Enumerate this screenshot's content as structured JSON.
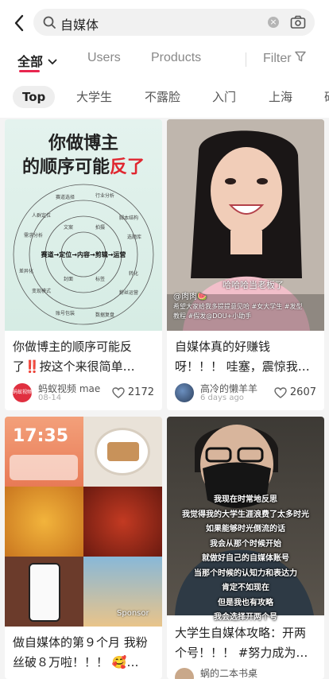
{
  "search": {
    "query": "自媒体"
  },
  "tabs": [
    {
      "label": "全部"
    },
    {
      "label": "Users"
    },
    {
      "label": "Products"
    },
    {
      "label": "Filter"
    }
  ],
  "chips": [
    "Top",
    "大学生",
    "不露脸",
    "入门",
    "上海",
    "研"
  ],
  "posts": [
    {
      "thumb_title_line1": "你做博主",
      "thumb_title_line2a": "的顺序可能",
      "thumb_title_line2b": "反了",
      "diagram_center": "赛道→定位→内容→剪辑→运营",
      "title_line1": "你做博主的顺序可能反",
      "title_line2": "了‼️按这个来很简单…",
      "author": "蚂蚁视频 mae",
      "date": "08-14",
      "avatar_text": "蚂蚁视频",
      "likes": "2172"
    },
    {
      "overlay_name": "@肉肉🍉",
      "overlay_caption": "哈哈哈当老板了",
      "overlay_small": "希望大家给我多提提意见哈 #女大学生 #发型教程 #假发@DOU+小助手",
      "title_line1": "自媒体真的好赚钱",
      "title_line2": "呀！！！ 哇塞，震惊我…",
      "author": "高冷的懒羊羊",
      "date": "6 days ago",
      "likes": "2607"
    },
    {
      "clock": "17:35",
      "sponsor": "Sponsor",
      "title_line1": "做自媒体的第９个月 我粉",
      "title_line2": "丝破８万啦！！！ 🥰…"
    },
    {
      "subtitle_lines": [
        "我现在时常地反思",
        "我觉得我的大学生涯浪费了太多时光",
        "如果能够时光倒流的话",
        "我会从那个时候开始",
        "就做好自己的自媒体账号",
        "当那个时候的认知力和表达力",
        "肯定不如现在",
        "但是我也有攻略",
        "我会选择开两个号"
      ],
      "title_line1": "大学生自媒体攻略：开两",
      "title_line2": "个号！！！ #努力成为…",
      "author": "蜗的二本书桌"
    }
  ],
  "colors": {
    "accent": "#e8264f",
    "background": "#f4f4f4"
  }
}
